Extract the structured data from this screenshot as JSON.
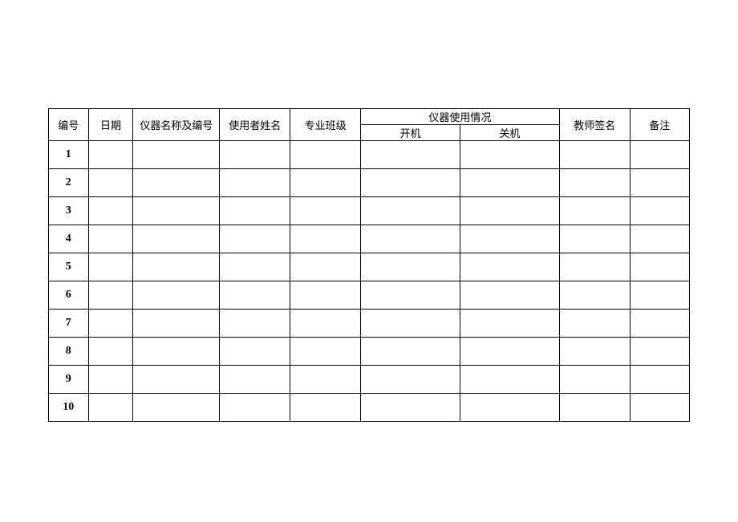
{
  "headers": {
    "num": "编号",
    "date": "日期",
    "instrument": "仪器名称及编号",
    "user": "使用者姓名",
    "class": "专业班级",
    "usage_group": "仪器使用情况",
    "usage_on": "开机",
    "usage_off": "关机",
    "sign": "教师签名",
    "note": "备注"
  },
  "rows": [
    {
      "num": "1",
      "date": "",
      "instrument": "",
      "user": "",
      "class": "",
      "on": "",
      "off": "",
      "sign": "",
      "note": ""
    },
    {
      "num": "2",
      "date": "",
      "instrument": "",
      "user": "",
      "class": "",
      "on": "",
      "off": "",
      "sign": "",
      "note": ""
    },
    {
      "num": "3",
      "date": "",
      "instrument": "",
      "user": "",
      "class": "",
      "on": "",
      "off": "",
      "sign": "",
      "note": ""
    },
    {
      "num": "4",
      "date": "",
      "instrument": "",
      "user": "",
      "class": "",
      "on": "",
      "off": "",
      "sign": "",
      "note": ""
    },
    {
      "num": "5",
      "date": "",
      "instrument": "",
      "user": "",
      "class": "",
      "on": "",
      "off": "",
      "sign": "",
      "note": ""
    },
    {
      "num": "6",
      "date": "",
      "instrument": "",
      "user": "",
      "class": "",
      "on": "",
      "off": "",
      "sign": "",
      "note": ""
    },
    {
      "num": "7",
      "date": "",
      "instrument": "",
      "user": "",
      "class": "",
      "on": "",
      "off": "",
      "sign": "",
      "note": ""
    },
    {
      "num": "8",
      "date": "",
      "instrument": "",
      "user": "",
      "class": "",
      "on": "",
      "off": "",
      "sign": "",
      "note": ""
    },
    {
      "num": "9",
      "date": "",
      "instrument": "",
      "user": "",
      "class": "",
      "on": "",
      "off": "",
      "sign": "",
      "note": ""
    },
    {
      "num": "10",
      "date": "",
      "instrument": "",
      "user": "",
      "class": "",
      "on": "",
      "off": "",
      "sign": "",
      "note": ""
    }
  ]
}
